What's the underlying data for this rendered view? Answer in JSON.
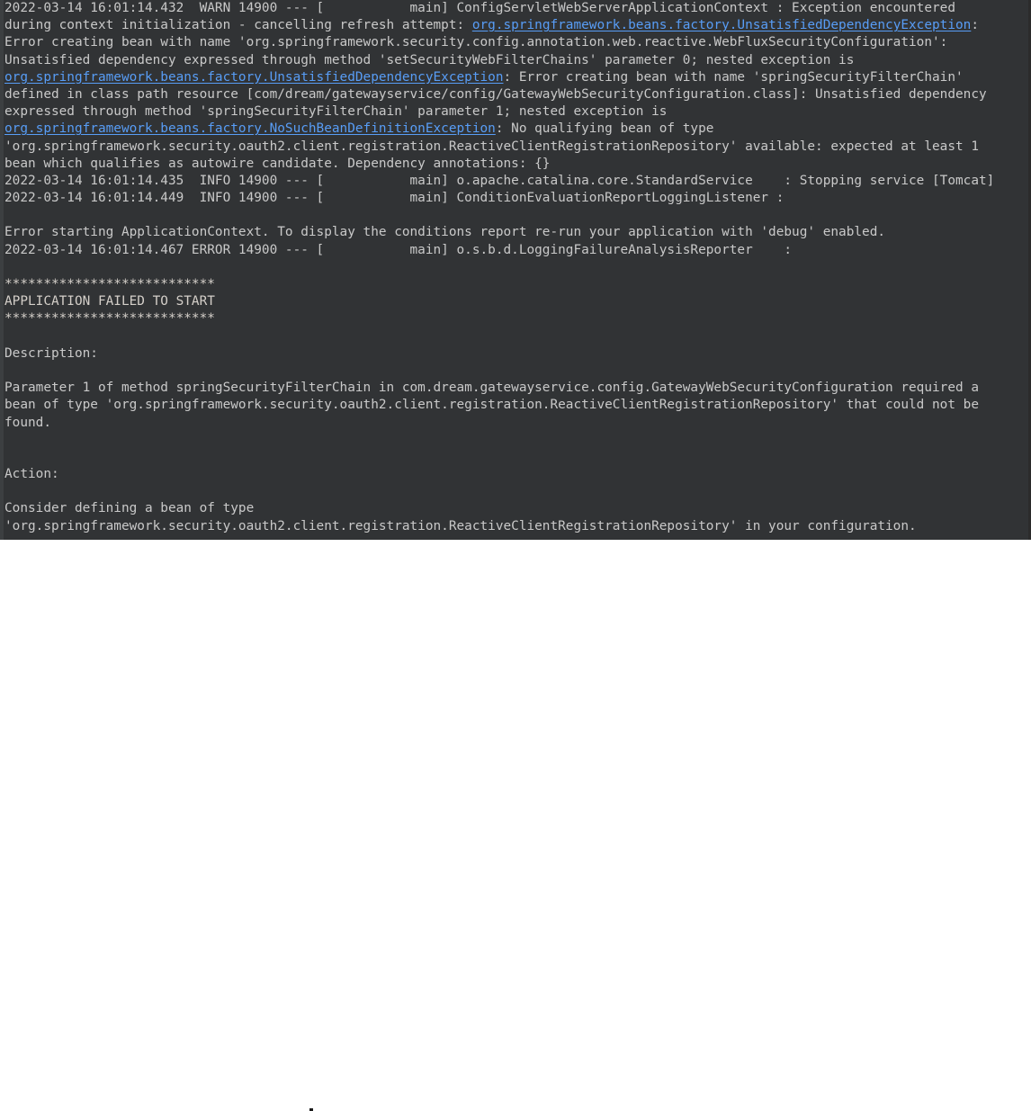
{
  "window": {
    "title": "Run Console",
    "background_color": "#313335",
    "text_color": "#c9c9c9",
    "link_color": "#589df6",
    "panel_color": "#ffffff"
  },
  "console": {
    "lines": [
      {
        "id": "line-1",
        "segments": [
          {
            "type": "text",
            "value": "2022-03-14 16:01:14.432  WARN 14900 --- [           main] ConfigServletWebServerApplicationContext : Exception encountered"
          }
        ]
      },
      {
        "id": "line-2",
        "segments": [
          {
            "type": "text",
            "value": "during context initialization - cancelling refresh attempt: "
          },
          {
            "type": "link",
            "value": "org.springframework.beans.factory.UnsatisfiedDependencyException"
          },
          {
            "type": "text",
            "value": ":"
          }
        ]
      },
      {
        "id": "line-3",
        "segments": [
          {
            "type": "text",
            "value": "Error creating bean with name 'org.springframework.security.config.annotation.web.reactive.WebFluxSecurityConfiguration':"
          }
        ]
      },
      {
        "id": "line-4",
        "segments": [
          {
            "type": "text",
            "value": "Unsatisfied dependency expressed through method 'setSecurityWebFilterChains' parameter 0; nested exception is"
          }
        ]
      },
      {
        "id": "line-5",
        "segments": [
          {
            "type": "link",
            "value": "org.springframework.beans.factory.UnsatisfiedDependencyException"
          },
          {
            "type": "text",
            "value": ": Error creating bean with name 'springSecurityFilterChain'"
          }
        ]
      },
      {
        "id": "line-6",
        "segments": [
          {
            "type": "text",
            "value": "defined in class path resource [com/dream/gatewayservice/config/GatewayWebSecurityConfiguration.class]: Unsatisfied dependency"
          }
        ]
      },
      {
        "id": "line-7",
        "segments": [
          {
            "type": "text",
            "value": "expressed through method 'springSecurityFilterChain' parameter 1; nested exception is"
          }
        ]
      },
      {
        "id": "line-8",
        "segments": [
          {
            "type": "link",
            "value": "org.springframework.beans.factory.NoSuchBeanDefinitionException"
          },
          {
            "type": "text",
            "value": ": No qualifying bean of type"
          }
        ]
      },
      {
        "id": "line-9",
        "segments": [
          {
            "type": "text",
            "value": "'org.springframework.security.oauth2.client.registration.ReactiveClientRegistrationRepository' available: expected at least 1"
          }
        ]
      },
      {
        "id": "line-10",
        "segments": [
          {
            "type": "text",
            "value": "bean which qualifies as autowire candidate. Dependency annotations: {}"
          }
        ]
      },
      {
        "id": "line-11",
        "segments": [
          {
            "type": "text",
            "value": "2022-03-14 16:01:14.435  INFO 14900 --- [           main] o.apache.catalina.core.StandardService    : Stopping service [Tomcat]"
          }
        ]
      },
      {
        "id": "line-12",
        "segments": [
          {
            "type": "text",
            "value": "2022-03-14 16:01:14.449  INFO 14900 --- [           main] ConditionEvaluationReportLoggingListener :"
          }
        ]
      },
      {
        "id": "line-13",
        "segments": [
          {
            "type": "text",
            "value": ""
          }
        ]
      },
      {
        "id": "line-14",
        "segments": [
          {
            "type": "text",
            "value": "Error starting ApplicationContext. To display the conditions report re-run your application with 'debug' enabled."
          }
        ]
      },
      {
        "id": "line-15",
        "segments": [
          {
            "type": "text",
            "value": "2022-03-14 16:01:14.467 ERROR 14900 --- [           main] o.s.b.d.LoggingFailureAnalysisReporter    :"
          }
        ]
      },
      {
        "id": "line-16",
        "segments": [
          {
            "type": "text",
            "value": ""
          }
        ]
      },
      {
        "id": "line-17",
        "segments": [
          {
            "type": "banner",
            "value": "***************************"
          }
        ]
      },
      {
        "id": "line-18",
        "segments": [
          {
            "type": "banner",
            "value": "APPLICATION FAILED TO START"
          }
        ]
      },
      {
        "id": "line-19",
        "segments": [
          {
            "type": "banner",
            "value": "***************************"
          }
        ]
      },
      {
        "id": "line-20",
        "segments": [
          {
            "type": "text",
            "value": ""
          }
        ]
      },
      {
        "id": "line-21",
        "segments": [
          {
            "type": "text",
            "value": "Description:"
          }
        ]
      },
      {
        "id": "line-22",
        "segments": [
          {
            "type": "text",
            "value": ""
          }
        ]
      },
      {
        "id": "line-23",
        "segments": [
          {
            "type": "text",
            "value": "Parameter 1 of method springSecurityFilterChain in com.dream.gatewayservice.config.GatewayWebSecurityConfiguration required a"
          }
        ]
      },
      {
        "id": "line-24",
        "segments": [
          {
            "type": "text",
            "value": "bean of type 'org.springframework.security.oauth2.client.registration.ReactiveClientRegistrationRepository' that could not be"
          }
        ]
      },
      {
        "id": "line-25",
        "segments": [
          {
            "type": "text",
            "value": "found."
          }
        ]
      },
      {
        "id": "line-26",
        "segments": [
          {
            "type": "text",
            "value": ""
          }
        ]
      },
      {
        "id": "line-27",
        "segments": [
          {
            "type": "text",
            "value": ""
          }
        ]
      },
      {
        "id": "line-28",
        "segments": [
          {
            "type": "text",
            "value": "Action:"
          }
        ]
      },
      {
        "id": "line-29",
        "segments": [
          {
            "type": "text",
            "value": ""
          }
        ]
      },
      {
        "id": "line-30",
        "segments": [
          {
            "type": "text",
            "value": "Consider defining a bean of type"
          }
        ]
      },
      {
        "id": "line-31",
        "segments": [
          {
            "type": "text",
            "value": "'org.springframework.security.oauth2.client.registration.ReactiveClientRegistrationRepository' in your configuration."
          }
        ]
      }
    ]
  }
}
